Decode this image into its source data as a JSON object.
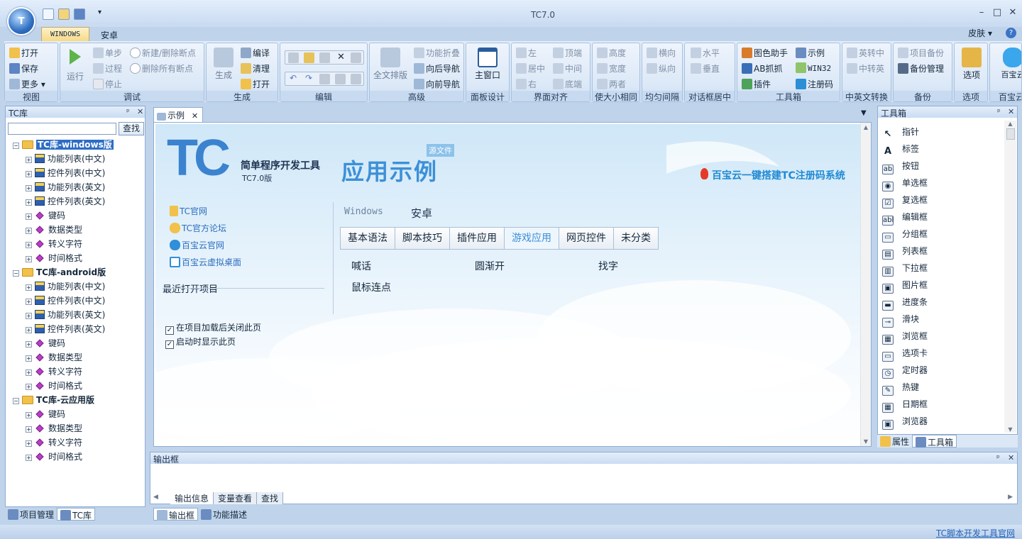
{
  "window": {
    "title": "TC7.0",
    "app_button": "T"
  },
  "ribbon_tabs": [
    "WINDOWS",
    "安卓"
  ],
  "skin": "皮肤",
  "groups": {
    "view": {
      "label": "视图",
      "items": [
        "打开",
        "保存",
        "更多"
      ]
    },
    "debug": {
      "label": "调试",
      "big": "运行",
      "items": [
        "单步",
        "过程",
        "停止",
        "新建/删除断点",
        "删除所有断点"
      ]
    },
    "build": {
      "label": "生成",
      "big": "生成",
      "items": [
        "编译",
        "清理",
        "打开"
      ]
    },
    "edit": {
      "label": "编辑"
    },
    "advanced": {
      "label": "高级",
      "big": "全文排版",
      "items": [
        "功能折叠",
        "向后导航",
        "向前导航"
      ]
    },
    "panel": {
      "label": "面板设计",
      "big": "主窗口"
    },
    "align": {
      "label": "界面对齐",
      "items": [
        "左",
        "居中",
        "右",
        "顶端",
        "中间",
        "底端"
      ]
    },
    "size": {
      "label": "使大小相同",
      "items": [
        "高度",
        "宽度",
        "两者"
      ]
    },
    "spacing": {
      "label": "均匀间隔",
      "items": [
        "横向",
        "纵向"
      ]
    },
    "center": {
      "label": "对话框居中",
      "items": [
        "水平",
        "垂直"
      ]
    },
    "toolbox": {
      "label": "工具箱",
      "items": [
        "图色助手",
        "示例",
        "AB抓抓",
        "WIN32",
        "插件",
        "注册码"
      ]
    },
    "lang": {
      "label": "中英文转换",
      "items": [
        "英转中",
        "中转英"
      ]
    },
    "backup": {
      "label": "备份",
      "items": [
        "项目备份",
        "备份管理"
      ]
    },
    "options": {
      "label": "选项",
      "big": "选项"
    },
    "cloud": {
      "label": "百宝云",
      "big": "百宝云"
    }
  },
  "left_panel": {
    "title": "TC库",
    "search_button": "查找",
    "tree": [
      {
        "label": "TC库-windows版",
        "level": 0,
        "type": "folder"
      },
      {
        "label": "功能列表(中文)",
        "level": 1,
        "type": "grid"
      },
      {
        "label": "控件列表(中文)",
        "level": 1,
        "type": "grid"
      },
      {
        "label": "功能列表(英文)",
        "level": 1,
        "type": "grid"
      },
      {
        "label": "控件列表(英文)",
        "level": 1,
        "type": "grid"
      },
      {
        "label": "键码",
        "level": 1,
        "type": "diamond"
      },
      {
        "label": "数据类型",
        "level": 1,
        "type": "diamond"
      },
      {
        "label": "转义字符",
        "level": 1,
        "type": "diamond"
      },
      {
        "label": "时间格式",
        "level": 1,
        "type": "diamond"
      },
      {
        "label": "TC库-android版",
        "level": 0,
        "type": "folder"
      },
      {
        "label": "功能列表(中文)",
        "level": 1,
        "type": "grid"
      },
      {
        "label": "控件列表(中文)",
        "level": 1,
        "type": "grid"
      },
      {
        "label": "功能列表(英文)",
        "level": 1,
        "type": "grid"
      },
      {
        "label": "控件列表(英文)",
        "level": 1,
        "type": "grid"
      },
      {
        "label": "键码",
        "level": 1,
        "type": "diamond"
      },
      {
        "label": "数据类型",
        "level": 1,
        "type": "diamond"
      },
      {
        "label": "转义字符",
        "level": 1,
        "type": "diamond"
      },
      {
        "label": "时间格式",
        "level": 1,
        "type": "diamond"
      },
      {
        "label": "TC库-云应用版",
        "level": 0,
        "type": "folder"
      },
      {
        "label": "键码",
        "level": 1,
        "type": "diamond"
      },
      {
        "label": "数据类型",
        "level": 1,
        "type": "diamond"
      },
      {
        "label": "转义字符",
        "level": 1,
        "type": "diamond"
      },
      {
        "label": "时间格式",
        "level": 1,
        "type": "diamond"
      }
    ],
    "bottom_tabs": [
      "项目管理",
      "TC库"
    ]
  },
  "doc": {
    "tab": "示例",
    "logo_big": "TC",
    "logo_text": "简单程序开发工具",
    "logo_version": "TC7.0版",
    "heading": "应用示例",
    "source_badge": "源文件",
    "promo": "百宝云一键搭建TC注册码系统",
    "links": [
      "TC官网",
      "TC官方论坛",
      "百宝云官网",
      "百宝云虚拟桌面"
    ],
    "recent_title": "最近打开项目",
    "checks": [
      {
        "label": "在项目加载后关闭此页",
        "checked": true
      },
      {
        "label": "启动时显示此页",
        "checked": true
      }
    ],
    "platforms": [
      "Windows",
      "安卓"
    ],
    "subtabs": [
      "基本语法",
      "脚本技巧",
      "插件应用",
      "游戏应用",
      "网页控件",
      "未分类"
    ],
    "active_subtab": "游戏应用",
    "items": [
      "喊话",
      "圆渐开",
      "找字",
      "鼠标连点"
    ]
  },
  "right_panel": {
    "title": "工具箱",
    "tools": [
      "指针",
      "标签",
      "按钮",
      "单选框",
      "复选框",
      "编辑框",
      "分组框",
      "列表框",
      "下拉框",
      "图片框",
      "进度条",
      "滑块",
      "浏览框",
      "选项卡",
      "定时器",
      "热键",
      "日期框",
      "浏览器"
    ],
    "bottom_tabs": [
      "属性",
      "工具箱"
    ]
  },
  "output": {
    "title": "输出框",
    "tabs": [
      "输出信息",
      "变量查看",
      "查找"
    ],
    "bottom_tabs": [
      "输出框",
      "功能描述"
    ]
  },
  "status": {
    "link": "TC脚本开发工具官网"
  }
}
